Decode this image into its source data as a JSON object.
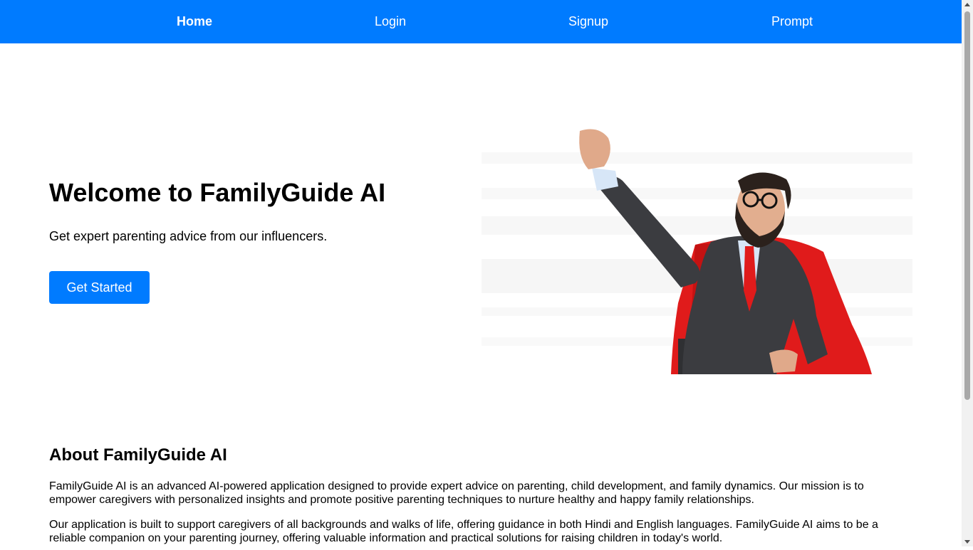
{
  "nav": {
    "home": "Home",
    "login": "Login",
    "signup": "Signup",
    "prompt": "Prompt"
  },
  "hero": {
    "title": "Welcome to FamilyGuide AI",
    "subtitle": "Get expert parenting advice from our influencers.",
    "cta_label": "Get Started"
  },
  "about": {
    "title": "About FamilyGuide AI",
    "paragraph1": "FamilyGuide AI is an advanced AI-powered application designed to provide expert advice on parenting, child development, and family dynamics. Our mission is to empower caregivers with personalized insights and promote positive parenting techniques to nurture healthy and happy family relationships.",
    "paragraph2": "Our application is built to support caregivers of all backgrounds and walks of life, offering guidance in both Hindi and English languages. FamilyGuide AI aims to be a reliable companion on your parenting journey, offering valuable information and practical solutions for raising children in today's world."
  },
  "colors": {
    "primary": "#007bff",
    "text": "#000000",
    "background": "#ffffff"
  },
  "icons": {
    "hero_image": "superhero-businessman-illustration"
  }
}
